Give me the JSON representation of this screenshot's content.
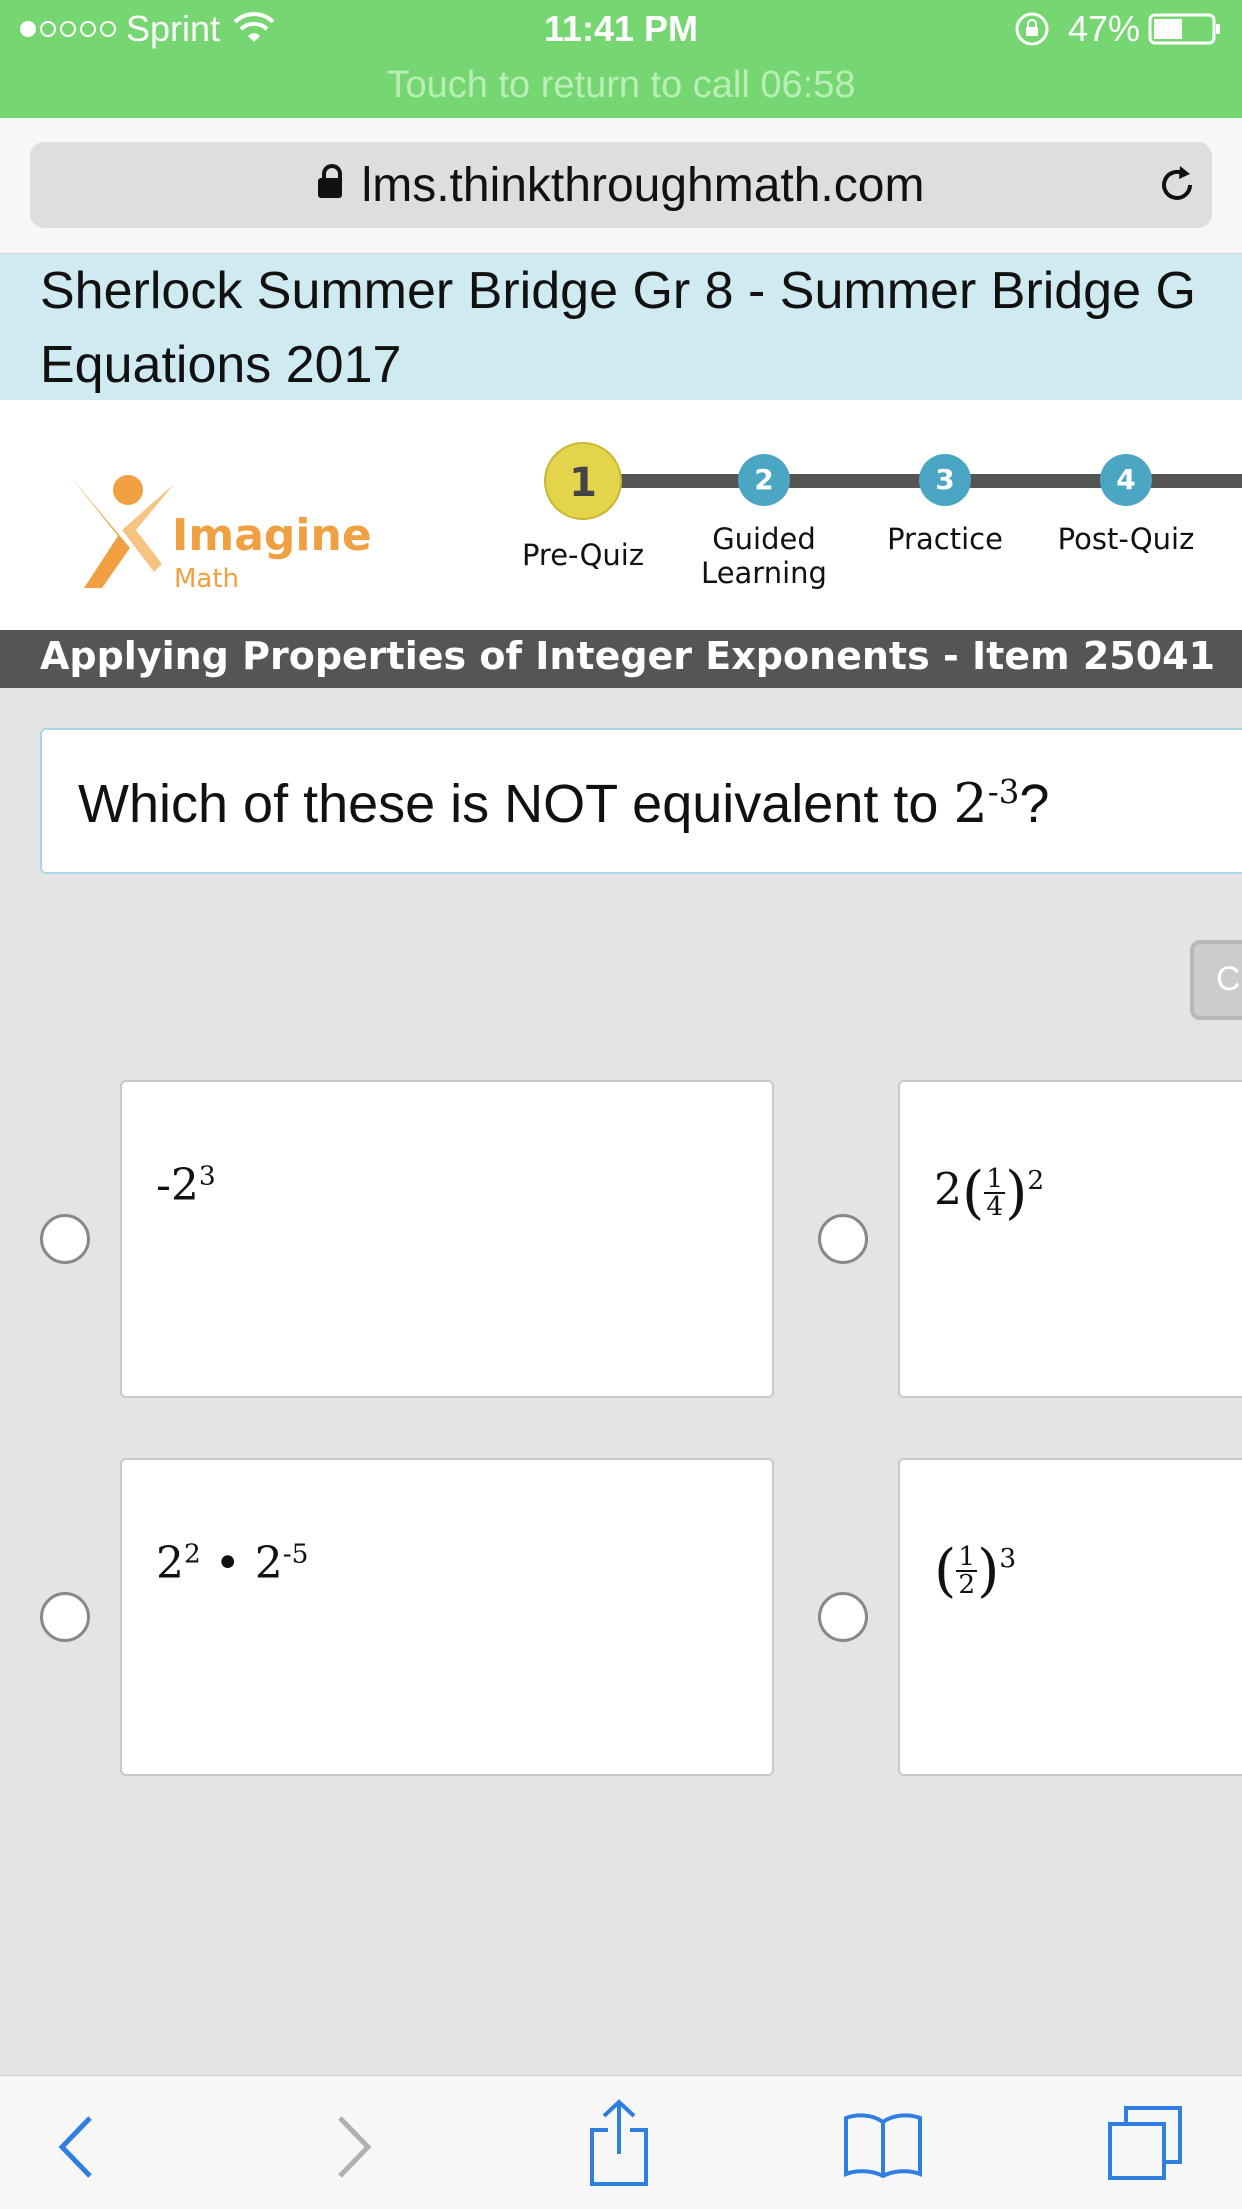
{
  "status_bar": {
    "carrier": "Sprint",
    "time": "11:41 PM",
    "battery": "47%",
    "call_banner": "Touch to return to call 06:58"
  },
  "browser": {
    "url": "lms.thinkthroughmath.com"
  },
  "course_title": "Sherlock Summer Bridge Gr 8 - Summer Bridge G",
  "course_title_line2": "Equations 2017",
  "logo": {
    "name": "Imagine",
    "sub": "Math"
  },
  "steps": [
    {
      "number": "1",
      "label": "Pre-Quiz",
      "active": true
    },
    {
      "number": "2",
      "label": "Guided Learning",
      "label_line1": "Guided",
      "label_line2": "Learning"
    },
    {
      "number": "3",
      "label": "Practice"
    },
    {
      "number": "4",
      "label": "Post-Quiz"
    }
  ],
  "item_title": "Applying Properties of Integer Exponents - Item 25041",
  "question": {
    "text": "Which of these is NOT equivalent to ",
    "base": "2",
    "exponent": "-3",
    "suffix": "?"
  },
  "clear_button": "Cl",
  "answers": [
    {
      "id": "a",
      "base": "-2",
      "exponent": "3"
    },
    {
      "id": "b",
      "coef": "2",
      "num": "1",
      "den": "4",
      "exponent": "2"
    },
    {
      "id": "c",
      "base1": "2",
      "exp1": "2",
      "op": "•",
      "base2": "2",
      "exp2": "-5"
    },
    {
      "id": "d",
      "num": "1",
      "den": "2",
      "exponent": "3"
    }
  ],
  "colors": {
    "status_green": "#76d672",
    "title_bg": "#cfebf1",
    "step_active": "#e3d44c",
    "step_inactive": "#4aa6c2",
    "logo_orange": "#f0a040"
  }
}
